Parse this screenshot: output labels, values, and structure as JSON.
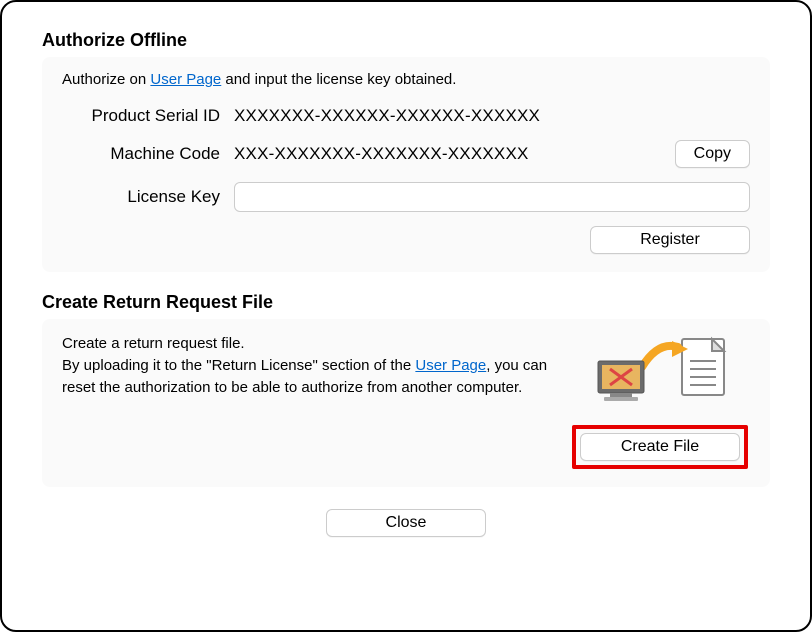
{
  "authorize": {
    "title": "Authorize Offline",
    "instruction_before": "Authorize on ",
    "instruction_link": "User Page",
    "instruction_after": " and input the license key obtained.",
    "serial_label": "Product Serial ID",
    "serial_value": "XXXXXXX-XXXXXX-XXXXXX-XXXXXX",
    "machine_label": "Machine Code",
    "machine_value": "XXX-XXXXXXX-XXXXXXX-XXXXXXX",
    "copy_label": "Copy",
    "license_label": "License Key",
    "license_value": "",
    "register_label": "Register"
  },
  "return": {
    "title": "Create Return Request File",
    "text_line1": "Create a return request file.",
    "text_line2_before": "By uploading it to the \"Return License\" section of the ",
    "text_line2_link": "User Page",
    "text_line2_after": ", you can reset the authorization to be able to authorize from another computer.",
    "create_label": "Create File"
  },
  "footer": {
    "close_label": "Close"
  }
}
